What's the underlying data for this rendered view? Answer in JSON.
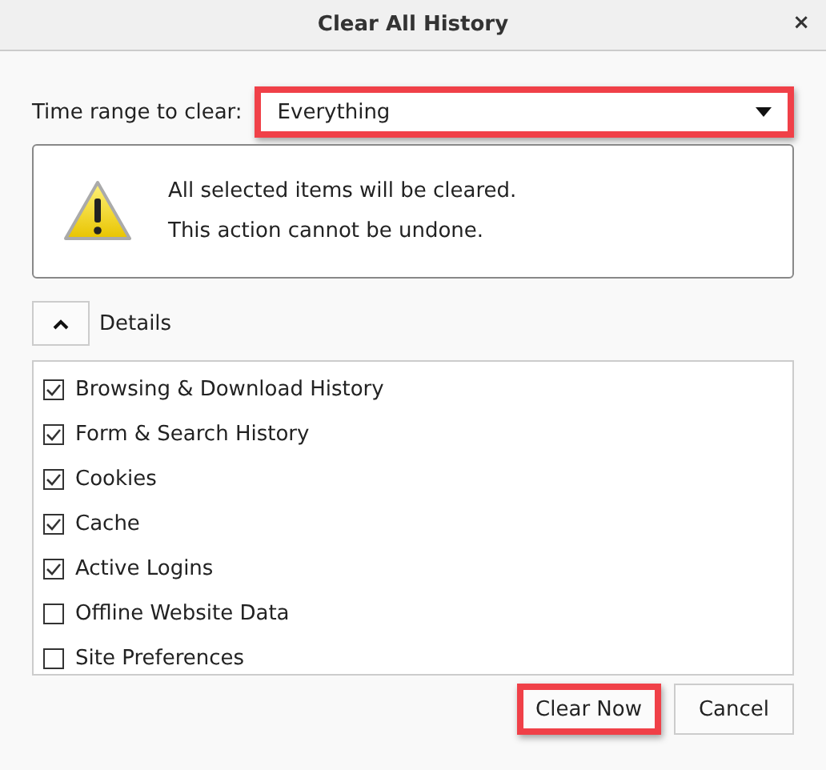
{
  "window": {
    "title": "Clear All History",
    "close": "×"
  },
  "time_range": {
    "label": "Time range to clear:",
    "value": "Everything",
    "highlighted": true
  },
  "warning": {
    "lines": [
      "All selected items will be cleared.",
      "This action cannot be undone."
    ]
  },
  "details": {
    "label": "Details",
    "expanded": true
  },
  "items": [
    {
      "label": "Browsing & Download History",
      "checked": true
    },
    {
      "label": "Form & Search History",
      "checked": true
    },
    {
      "label": "Cookies",
      "checked": true
    },
    {
      "label": "Cache",
      "checked": true
    },
    {
      "label": "Active Logins",
      "checked": true
    },
    {
      "label": "Offline Website Data",
      "checked": false
    },
    {
      "label": "Site Preferences",
      "checked": false
    }
  ],
  "buttons": [
    {
      "label": "Clear Now",
      "highlighted": true
    },
    {
      "label": "Cancel",
      "highlighted": false
    }
  ]
}
